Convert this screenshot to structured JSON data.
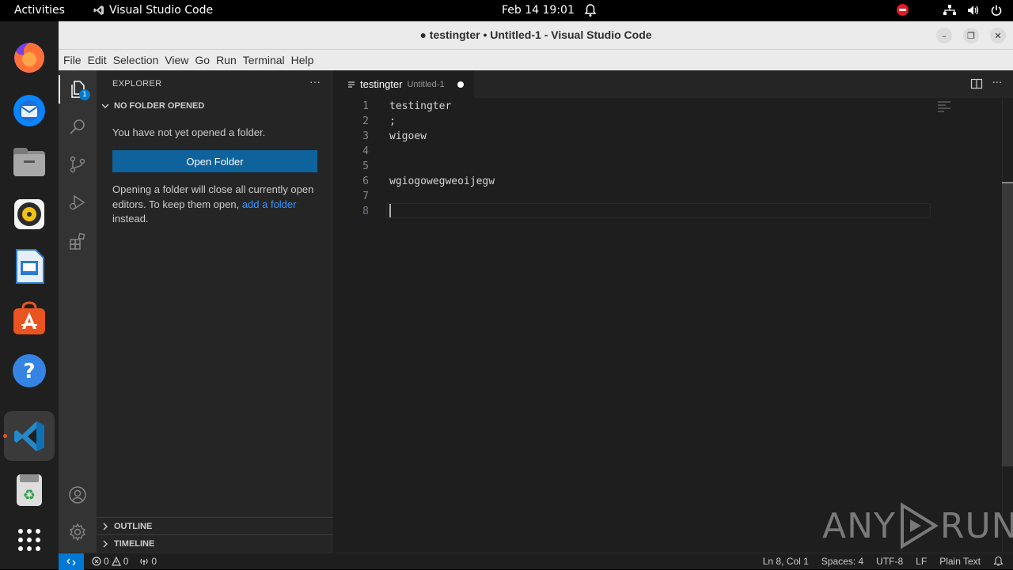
{
  "topbar": {
    "activities": "Activities",
    "app_name": "Visual Studio Code",
    "clock": "Feb 14  19:01"
  },
  "dock": {
    "apps": [
      "firefox-icon",
      "thunderbird-icon",
      "files-icon",
      "rhythmbox-icon",
      "libreoffice-impress-icon",
      "app-center-icon",
      "help-icon",
      "vscode-icon",
      "trash-icon",
      "show-apps-icon"
    ]
  },
  "window": {
    "title": "● testingter • Untitled-1 - Visual Studio Code"
  },
  "menubar": {
    "items": [
      "File",
      "Edit",
      "Selection",
      "View",
      "Go",
      "Run",
      "Terminal",
      "Help"
    ]
  },
  "activitybar": {
    "explorer_badge": "1"
  },
  "sidebar": {
    "title": "EXPLORER",
    "section": "NO FOLDER OPENED",
    "message": "You have not yet opened a folder.",
    "open_folder_button": "Open Folder",
    "note_prefix": "Opening a folder will close all currently open editors. To keep them open, ",
    "note_link": "add a folder",
    "note_suffix": " instead.",
    "outline": "OUTLINE",
    "timeline": "TIMELINE"
  },
  "editor": {
    "tab_name": "testingter",
    "tab_description": "Untitled-1",
    "lines": [
      {
        "num": "1",
        "text": "testingter"
      },
      {
        "num": "2",
        "text": ";"
      },
      {
        "num": "3",
        "text": "wigoew"
      },
      {
        "num": "4",
        "text": ""
      },
      {
        "num": "5",
        "text": ""
      },
      {
        "num": "6",
        "text": "wgiogowegweoijegw"
      },
      {
        "num": "7",
        "text": ""
      },
      {
        "num": "8",
        "text": ""
      }
    ]
  },
  "watermark": {
    "left": "ANY",
    "right": "RUN"
  },
  "statusbar": {
    "errors": "0",
    "warnings": "0",
    "ports": "0",
    "position": "Ln 8, Col 1",
    "spaces": "Spaces: 4",
    "encoding": "UTF-8",
    "eol": "LF",
    "language": "Plain Text"
  }
}
